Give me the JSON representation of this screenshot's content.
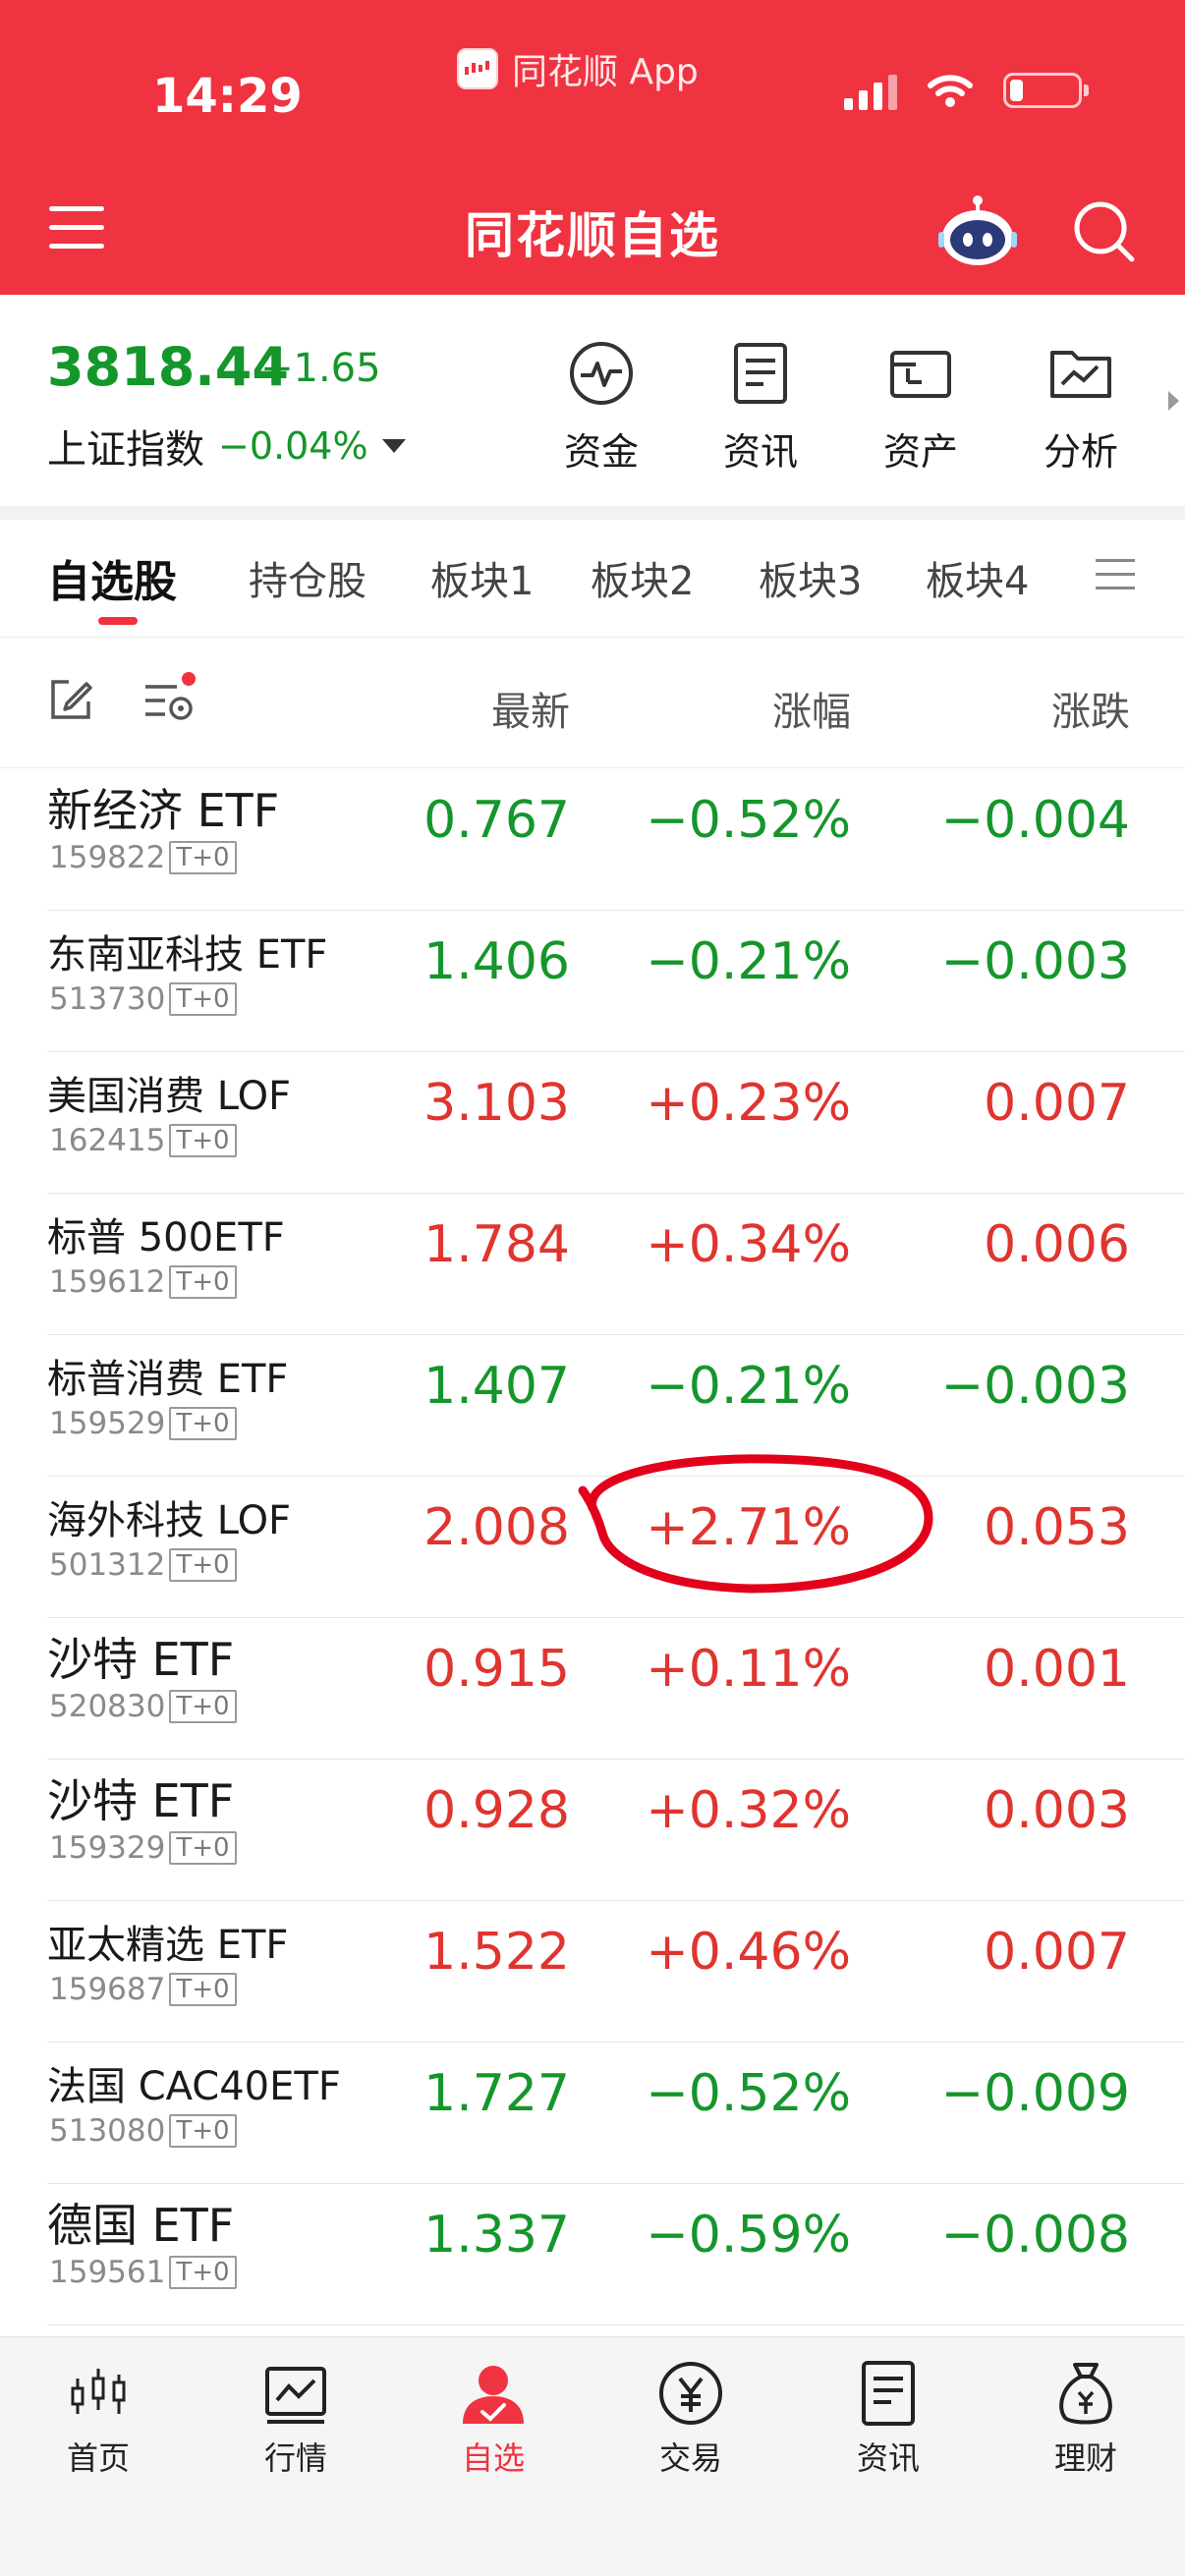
{
  "status_bar": {
    "time": "14:29",
    "app_name": "同花顺 App"
  },
  "header": {
    "title": "同花顺自选"
  },
  "index": {
    "value": "3818.44",
    "change": "−1.65",
    "name": "上证指数",
    "pct": "−0.04%"
  },
  "quick_links": [
    {
      "label": "资金",
      "icon": "pulse-icon"
    },
    {
      "label": "资讯",
      "icon": "document-icon"
    },
    {
      "label": "资产",
      "icon": "wallet-icon"
    },
    {
      "label": "分析",
      "icon": "chart-folder-icon"
    }
  ],
  "tabs": [
    "自选股",
    "持仓股",
    "板块1",
    "板块2",
    "板块3",
    "板块4"
  ],
  "columns": {
    "latest": "最新",
    "pct": "涨幅",
    "change": "涨跌"
  },
  "rows": [
    {
      "name": "新经济 ETF",
      "code": "159822",
      "tag": "T+0",
      "price": "0.767",
      "pct": "−0.52%",
      "chg": "−0.004",
      "dir": "down"
    },
    {
      "name": "东南亚科技 ETF",
      "code": "513730",
      "tag": "T+0",
      "price": "1.406",
      "pct": "−0.21%",
      "chg": "−0.003",
      "dir": "down"
    },
    {
      "name": "美国消费 LOF",
      "code": "162415",
      "tag": "T+0",
      "price": "3.103",
      "pct": "+0.23%",
      "chg": "0.007",
      "dir": "up"
    },
    {
      "name": "标普 500ETF",
      "code": "159612",
      "tag": "T+0",
      "price": "1.784",
      "pct": "+0.34%",
      "chg": "0.006",
      "dir": "up"
    },
    {
      "name": "标普消费 ETF",
      "code": "159529",
      "tag": "T+0",
      "price": "1.407",
      "pct": "−0.21%",
      "chg": "−0.003",
      "dir": "down"
    },
    {
      "name": "海外科技 LOF",
      "code": "501312",
      "tag": "T+0",
      "price": "2.008",
      "pct": "+2.71%",
      "chg": "0.053",
      "dir": "up"
    },
    {
      "name": "沙特 ETF",
      "code": "520830",
      "tag": "T+0",
      "price": "0.915",
      "pct": "+0.11%",
      "chg": "0.001",
      "dir": "up"
    },
    {
      "name": "沙特 ETF",
      "code": "159329",
      "tag": "T+0",
      "price": "0.928",
      "pct": "+0.32%",
      "chg": "0.003",
      "dir": "up"
    },
    {
      "name": "亚太精选 ETF",
      "code": "159687",
      "tag": "T+0",
      "price": "1.522",
      "pct": "+0.46%",
      "chg": "0.007",
      "dir": "up"
    },
    {
      "name": "法国 CAC40ETF",
      "code": "513080",
      "tag": "T+0",
      "price": "1.727",
      "pct": "−0.52%",
      "chg": "−0.009",
      "dir": "down"
    },
    {
      "name": "德国 ETF",
      "code": "159561",
      "tag": "T+0",
      "price": "1.337",
      "pct": "−0.59%",
      "chg": "−0.008",
      "dir": "down"
    }
  ],
  "bottom_nav": [
    {
      "label": "首页",
      "icon": "candlestick-icon"
    },
    {
      "label": "行情",
      "icon": "market-chart-icon"
    },
    {
      "label": "自选",
      "icon": "user-check-icon",
      "active": true
    },
    {
      "label": "交易",
      "icon": "yuan-icon"
    },
    {
      "label": "资讯",
      "icon": "news-icon"
    },
    {
      "label": "理财",
      "icon": "money-bag-icon"
    }
  ],
  "colors": {
    "brand": "#ef3340",
    "up": "#e0342f",
    "down": "#14962b"
  }
}
